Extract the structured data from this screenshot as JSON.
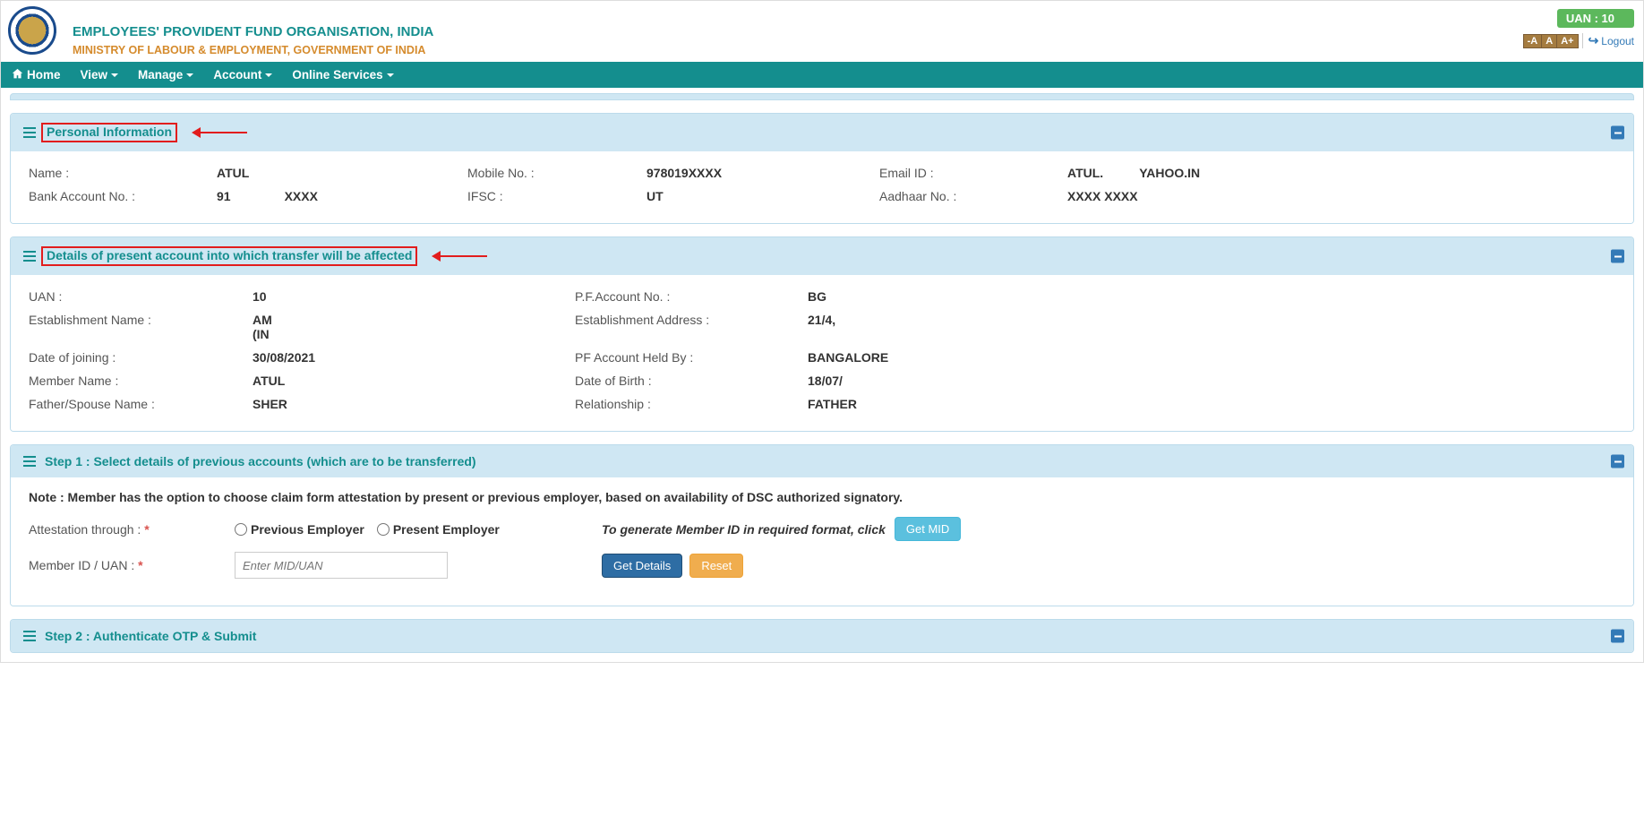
{
  "header": {
    "org_title": "EMPLOYEES' PROVIDENT FUND ORGANISATION, INDIA",
    "org_sub": "MINISTRY OF LABOUR & EMPLOYMENT, GOVERNMENT OF INDIA",
    "uan_badge": "UAN : 10",
    "font_minus": "-A",
    "font_normal": "A",
    "font_plus": "A+",
    "logout": "Logout"
  },
  "nav": {
    "home": "Home",
    "view": "View",
    "manage": "Manage",
    "account": "Account",
    "online_services": "Online Services"
  },
  "panels": {
    "personal": {
      "title": "Personal Information",
      "name_lbl": "Name :",
      "name_val": "ATUL",
      "mobile_lbl": "Mobile No. :",
      "mobile_val": "978019XXXX",
      "email_lbl": "Email ID :",
      "email_val_a": "ATUL.",
      "email_val_b": "YAHOO.IN",
      "bank_lbl": "Bank Account No. :",
      "bank_val_a": "91",
      "bank_val_b": "XXXX",
      "ifsc_lbl": "IFSC :",
      "ifsc_val": "UT",
      "aadhaar_lbl": "Aadhaar No. :",
      "aadhaar_val": "XXXX XXXX"
    },
    "present": {
      "title": "Details of present account into which transfer will be affected",
      "uan_lbl": "UAN :",
      "uan_val": "10",
      "pf_lbl": "P.F.Account No. :",
      "pf_val": "BG",
      "est_name_lbl": "Establishment Name :",
      "est_name_val_a": "AM",
      "est_name_val_b": "(IN",
      "est_addr_lbl": "Establishment Address :",
      "est_addr_val": "21/4,",
      "doj_lbl": "Date of joining :",
      "doj_val": "30/08/2021",
      "held_lbl": "PF Account Held By :",
      "held_val": "BANGALORE",
      "member_lbl": "Member Name :",
      "member_val": "ATUL",
      "dob_lbl": "Date of Birth :",
      "dob_val": "18/07/",
      "father_lbl": "Father/Spouse Name :",
      "father_val": "SHER",
      "rel_lbl": "Relationship :",
      "rel_val": "FATHER"
    },
    "step1": {
      "title": "Step 1 : Select details of previous accounts (which are to be transferred)",
      "note": "Note : Member has the option to choose claim form attestation by present or previous employer, based on availability of DSC authorized signatory.",
      "attest_lbl": "Attestation through :",
      "prev_emp": "Previous Employer",
      "pres_emp": "Present Employer",
      "gen_text": "To generate Member ID in required format, click",
      "get_mid": "Get MID",
      "mid_lbl": "Member ID / UAN :",
      "mid_placeholder": "Enter MID/UAN",
      "get_details": "Get Details",
      "reset": "Reset"
    },
    "step2": {
      "title": "Step 2 : Authenticate OTP & Submit"
    }
  }
}
